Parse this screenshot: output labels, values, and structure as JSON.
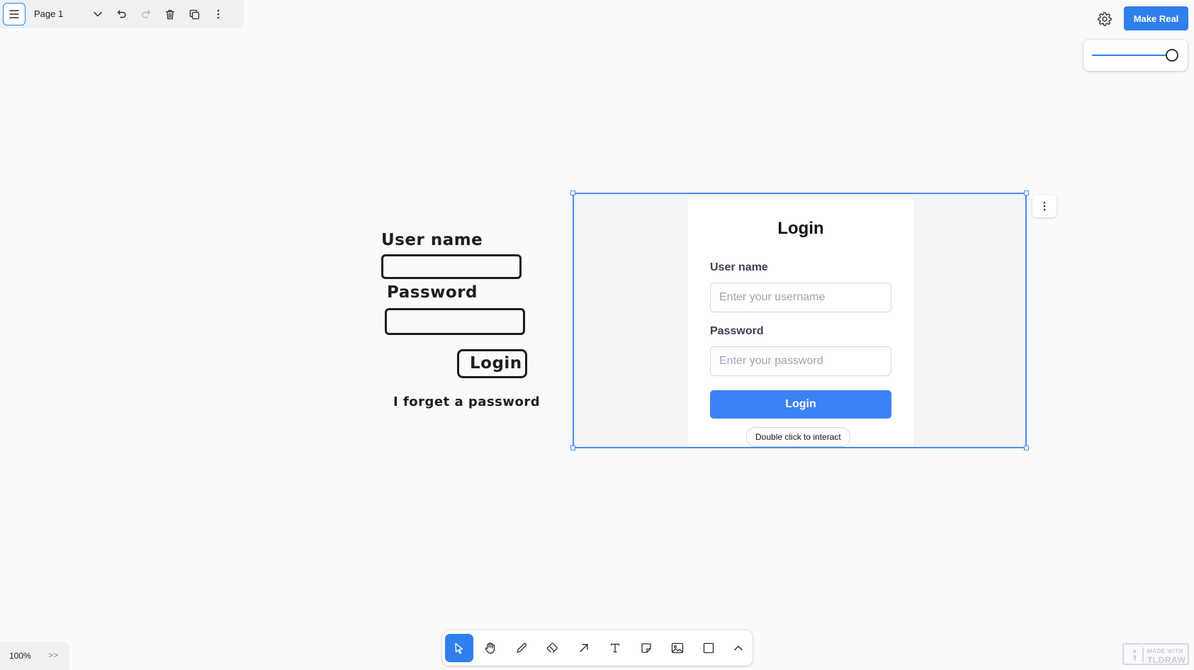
{
  "topbar": {
    "page_name": "Page 1",
    "icons": [
      "menu-icon",
      "chevron-down-icon",
      "undo-icon",
      "redo-icon",
      "trash-icon",
      "duplicate-icon",
      "more-vertical-icon"
    ]
  },
  "actions": {
    "make_real_label": "Make Real"
  },
  "sketch": {
    "username_label": "User name",
    "password_label": "Password",
    "login_label": "Login",
    "forgot_label": "I forget a password"
  },
  "preview": {
    "title": "Login",
    "username_label": "User name",
    "username_placeholder": "Enter your username",
    "password_label": "Password",
    "password_placeholder": "Enter your password",
    "login_button": "Login",
    "hint": "Double click to interact"
  },
  "toolbar": {
    "tools": [
      "select",
      "hand",
      "draw",
      "eraser",
      "arrow",
      "text",
      "note",
      "asset",
      "rectangle",
      "more"
    ],
    "active_tool": "select"
  },
  "zoom": {
    "level": "100%",
    "more_label": ">>"
  },
  "watermark": {
    "line1": "MADE WITH",
    "line2": "TLDRAW"
  },
  "colors": {
    "accent": "#2f80ed",
    "preview_button": "#3b82f6",
    "canvas": "#f9fafb"
  }
}
